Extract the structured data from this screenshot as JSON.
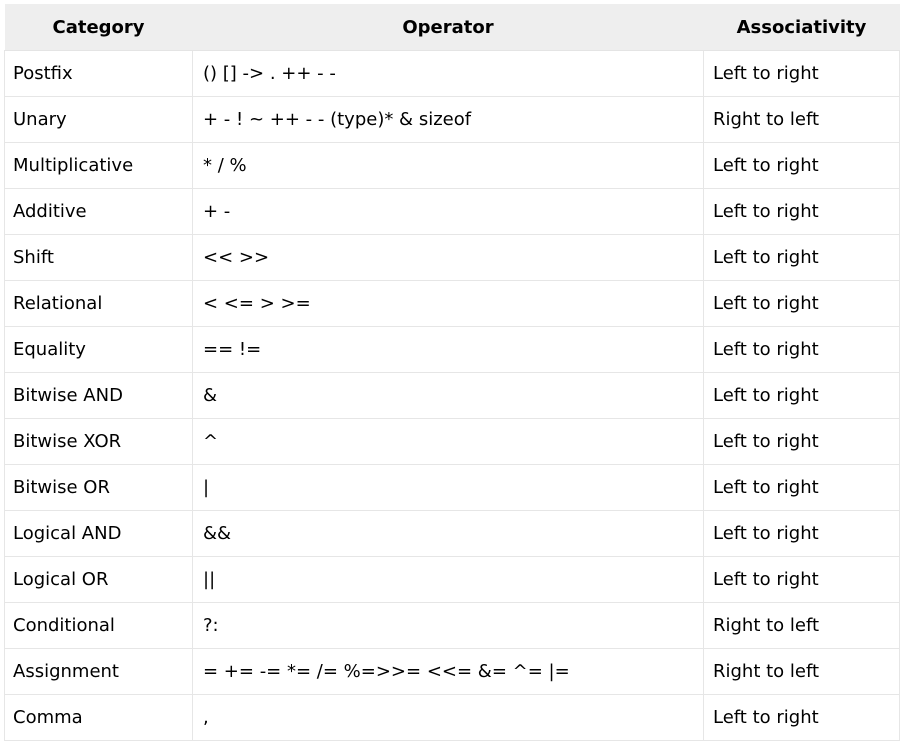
{
  "table": {
    "headers": [
      "Category",
      "Operator",
      "Associativity"
    ],
    "rows": [
      {
        "category": "Postfix",
        "operator": "() [] -> . ++ - -",
        "associativity": "Left to right"
      },
      {
        "category": "Unary",
        "operator": "+ - ! ~ ++ - - (type)* & sizeof",
        "associativity": "Right to left"
      },
      {
        "category": "Multiplicative",
        "operator": "* / %",
        "associativity": "Left to right"
      },
      {
        "category": "Additive",
        "operator": "+ -",
        "associativity": "Left to right"
      },
      {
        "category": "Shift",
        "operator": "<< >>",
        "associativity": "Left to right"
      },
      {
        "category": "Relational",
        "operator": "< <= > >=",
        "associativity": "Left to right"
      },
      {
        "category": "Equality",
        "operator": "== !=",
        "associativity": "Left to right"
      },
      {
        "category": "Bitwise AND",
        "operator": "&",
        "associativity": "Left to right"
      },
      {
        "category": "Bitwise XOR",
        "operator": "^",
        "associativity": "Left to right"
      },
      {
        "category": "Bitwise OR",
        "operator": "|",
        "associativity": "Left to right"
      },
      {
        "category": "Logical AND",
        "operator": "&&",
        "associativity": "Left to right"
      },
      {
        "category": "Logical OR",
        "operator": "||",
        "associativity": "Left to right"
      },
      {
        "category": "Conditional",
        "operator": "?:",
        "associativity": "Right to left"
      },
      {
        "category": "Assignment",
        "operator": "= += -= *= /= %=>>= <<= &= ^= |=",
        "associativity": "Right to left"
      },
      {
        "category": "Comma",
        "operator": ",",
        "associativity": "Left to right"
      }
    ]
  }
}
